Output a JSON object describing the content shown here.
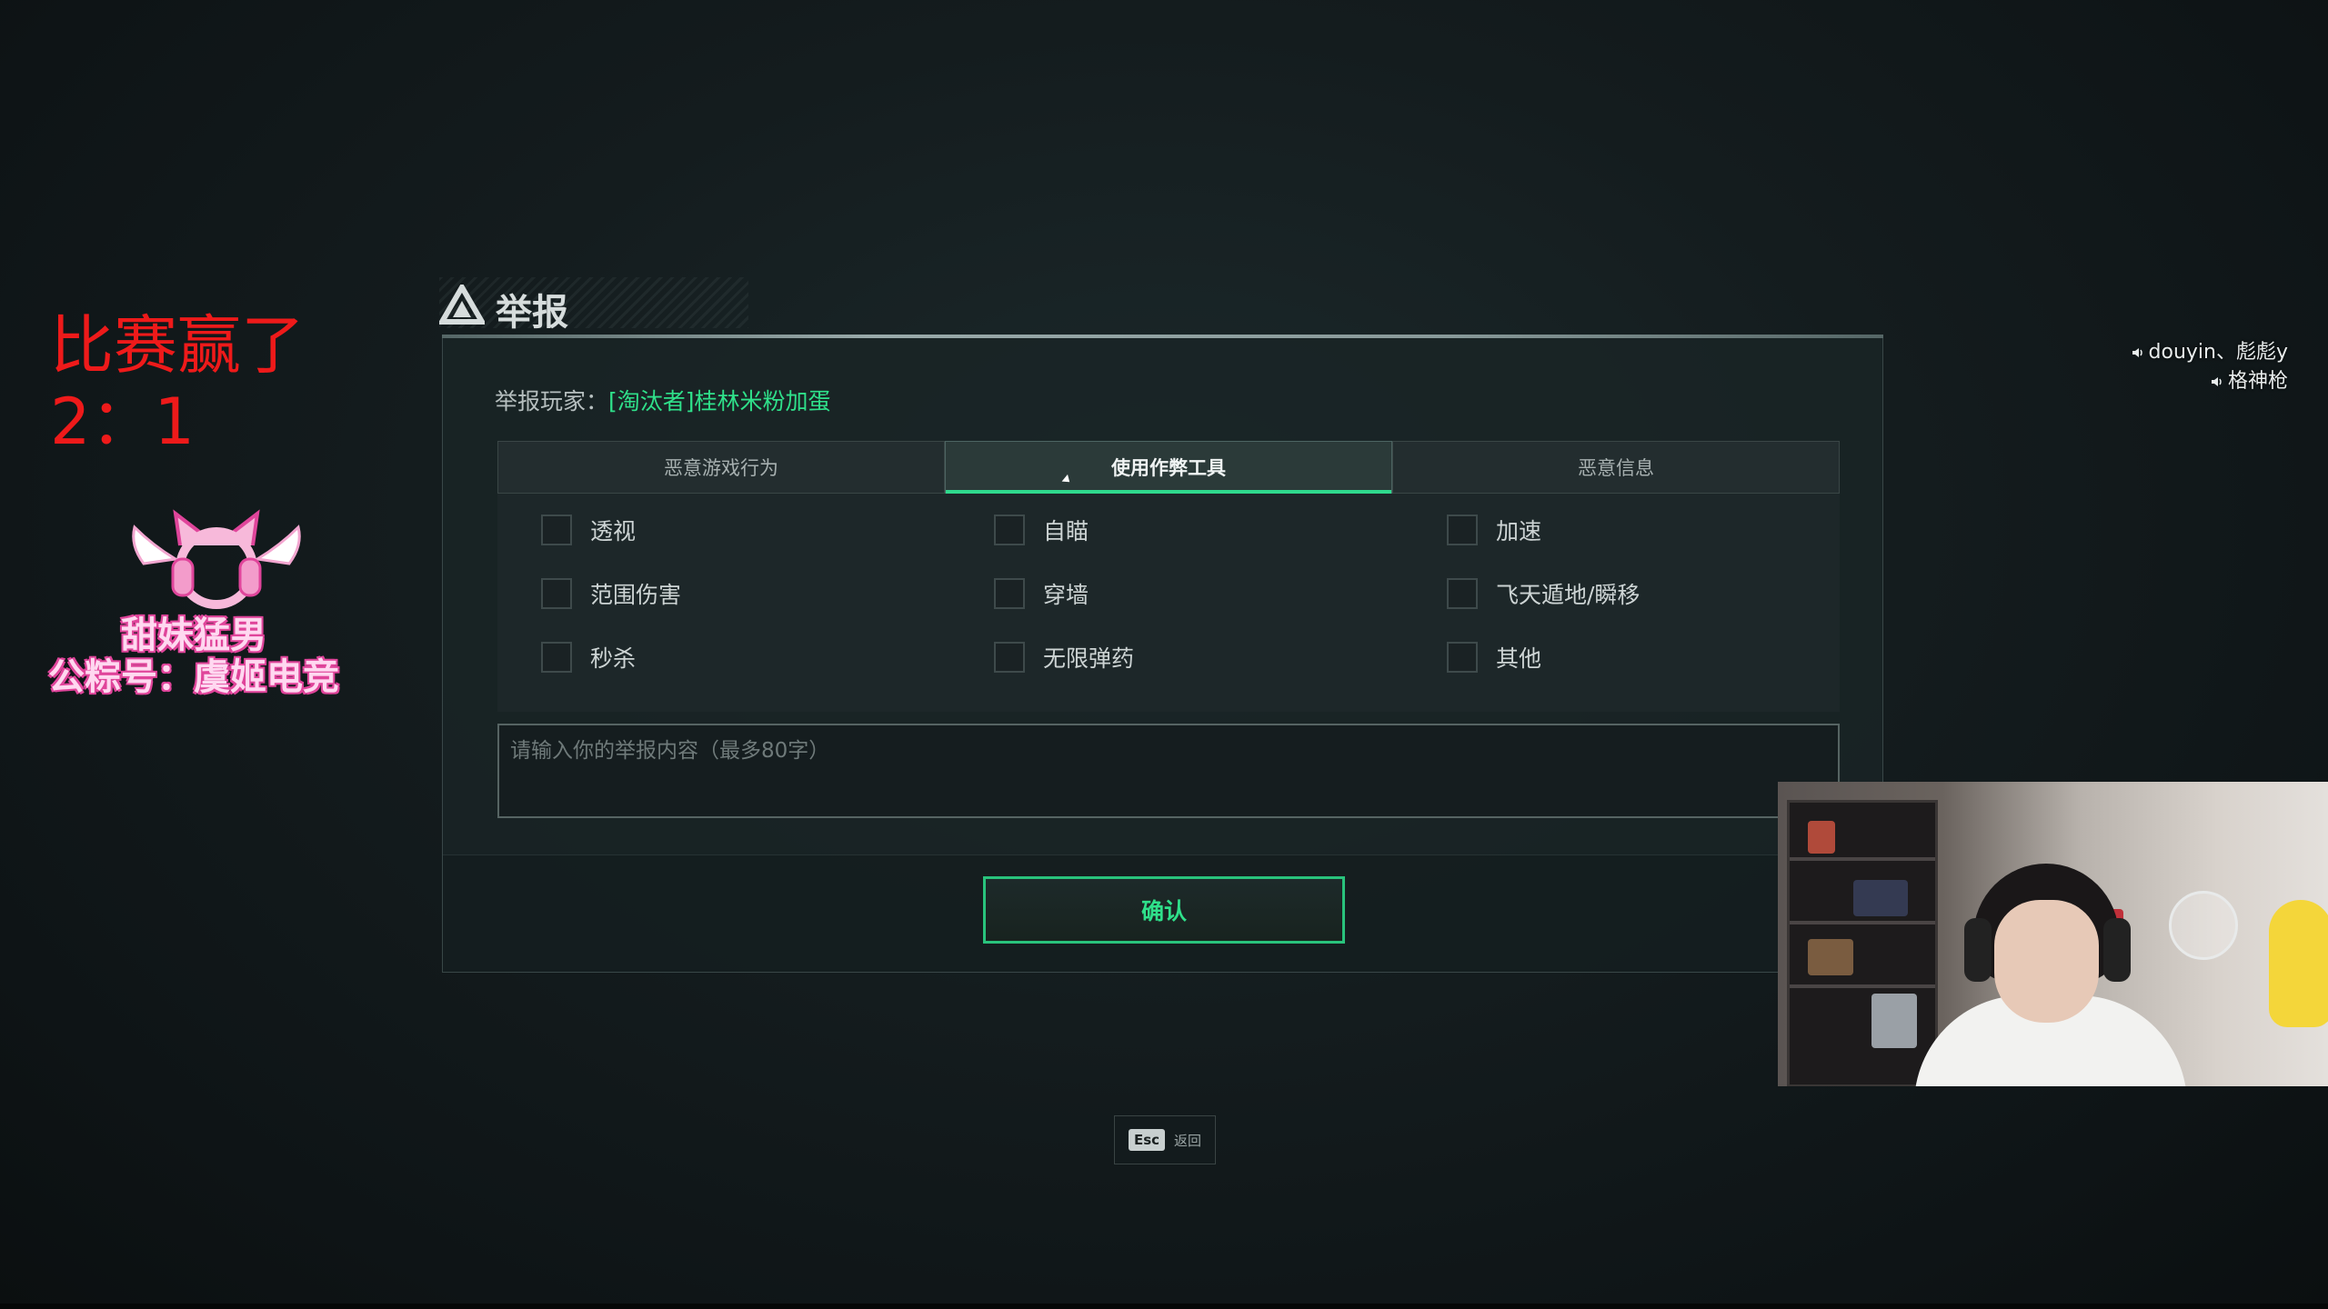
{
  "stream_overlay": {
    "score_line1": "比赛赢了",
    "score_line2": "2：1",
    "logo_line1": "甜妹猛男",
    "logo_line2": "公粽号：虞姬电竞"
  },
  "voice_chat": [
    {
      "icon": "speaker-icon",
      "name": "douyin、彪彪y"
    },
    {
      "icon": "speaker-icon",
      "name": "格神枪"
    }
  ],
  "dialog": {
    "title": "举报",
    "reported_label": "举报玩家：",
    "reported_name": "[淘汰者]桂林米粉加蛋",
    "tabs": [
      {
        "label": "恶意游戏行为",
        "active": false
      },
      {
        "label": "使用作弊工具",
        "active": true
      },
      {
        "label": "恶意信息",
        "active": false
      }
    ],
    "options": [
      {
        "label": "透视",
        "checked": false
      },
      {
        "label": "自瞄",
        "checked": false
      },
      {
        "label": "加速",
        "checked": false
      },
      {
        "label": "范围伤害",
        "checked": false
      },
      {
        "label": "穿墙",
        "checked": false
      },
      {
        "label": "飞天遁地/瞬移",
        "checked": false
      },
      {
        "label": "秒杀",
        "checked": false
      },
      {
        "label": "无限弹药",
        "checked": false
      },
      {
        "label": "其他",
        "checked": false
      }
    ],
    "textarea_placeholder": "请输入你的举报内容（最多80字）",
    "textarea_value": "",
    "confirm_label": "确认"
  },
  "footer": {
    "esc_key": "Esc",
    "esc_label": "返回"
  },
  "colors": {
    "accent": "#2fe08a",
    "score_red": "#ee1a1a",
    "logo_pink": "#e0459b"
  }
}
